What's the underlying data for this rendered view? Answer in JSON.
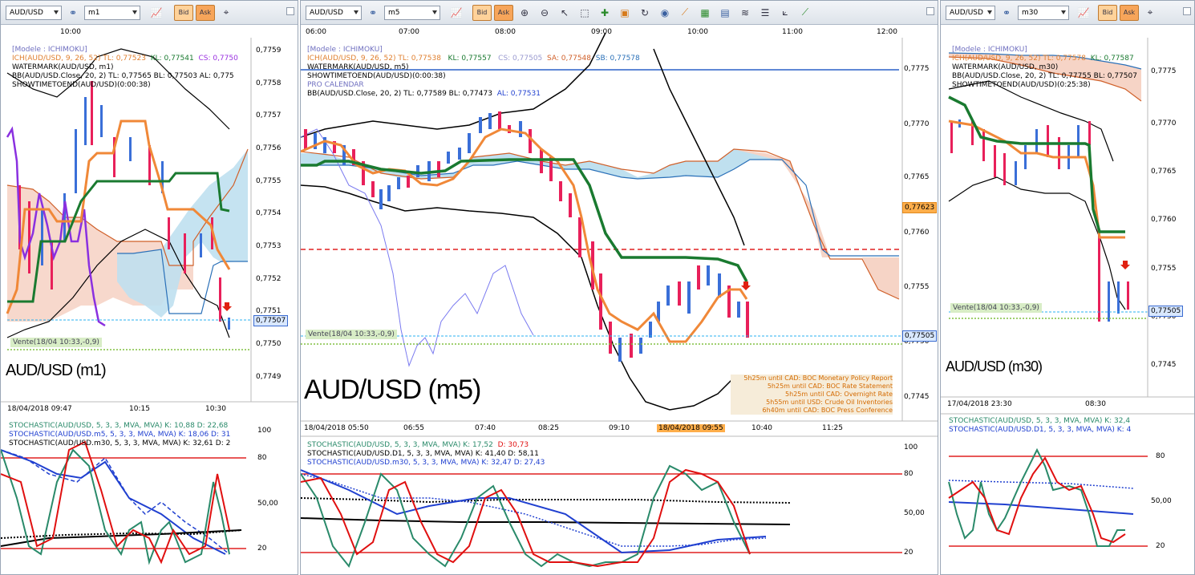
{
  "panels": [
    {
      "symbol": "AUD/USD",
      "timeframe": "m1",
      "bid": "Bid",
      "ask": "Ask",
      "time_top": [
        "10:00"
      ],
      "info": [
        {
          "text": "[Modele : ICHIMOKU]",
          "color": "#7070c0"
        },
        {
          "text": "ICH(AUD/USD, 9, 26, 52)  TL: 0,77523",
          "color": "#e08030",
          "kl": "KL: 0,77541",
          "cs": "CS: 0,7750"
        },
        {
          "text": "WATERMARK(AUD/USD, m1)",
          "color": "#000"
        },
        {
          "text": "BB(AUD/USD.Close, 20, 2)  TL: 0,77565  BL: 0,77503  AL: 0,775",
          "color": "#000"
        },
        {
          "text": "SHOWTIMETOEND(AUD/USD)(0:00:38)",
          "color": "#000"
        }
      ],
      "prices": [
        "0,7759",
        "0,7758",
        "0,7757",
        "0,7756",
        "0,7755",
        "0,7754",
        "0,7753",
        "0,7752",
        "0,7751",
        "0,7750",
        "0,7749"
      ],
      "current": "0,77507",
      "vente": "Vente(18/04 10:33,-0,9)",
      "watermark": "AUD/USD (m1)",
      "dates": [
        "18/04/2018 09:47",
        "10:15",
        "10:30"
      ],
      "stoch": [
        {
          "text": "STOCHASTIC(AUD/USD, 5, 3, 3, MVA, MVA)  K: 10,88  D: 22,68",
          "color": "#2a8a6a"
        },
        {
          "text": "STOCHASTIC(AUD/USD.m5, 5, 3, 3, MVA, MVA)  K: 18,06  D: 31",
          "color": "#2040d0"
        },
        {
          "text": "STOCHASTIC(AUD/USD.m30, 5, 3, 3, MVA, MVA)  K: 32,61  D: 2",
          "color": "#000"
        }
      ],
      "stoch_levels": [
        "100",
        "80",
        "50,00",
        "20"
      ]
    },
    {
      "symbol": "AUD/USD",
      "timeframe": "m5",
      "bid": "Bid",
      "ask": "Ask",
      "time_top": [
        "06:00",
        "07:00",
        "08:00",
        "09:00",
        "10:00",
        "11:00",
        "12:00"
      ],
      "info": [
        {
          "text": "[Modele : ICHIMOKU]",
          "color": "#7070c0"
        },
        {
          "text": "ICH(AUD/USD, 9, 26, 52)  TL: 0,77538",
          "color": "#e08030",
          "kl": "KL: 0,77557",
          "cs": "CS: 0,77505",
          "sa": "SA: 0,77548",
          "sb": "SB: 0,77578"
        },
        {
          "text": "WATERMARK(AUD/USD, m5)",
          "color": "#000"
        },
        {
          "text": "SHOWTIMETOEND(AUD/USD)(0:00:38)",
          "color": "#000"
        },
        {
          "text": "PRO CALENDAR",
          "color": "#7070c0"
        },
        {
          "text": "BB(AUD/USD.Close, 20, 2)  TL: 0,77589  BL: 0,77473",
          "color": "#000",
          "al": "AL: 0,77531"
        }
      ],
      "prices": [
        "0,7775",
        "0,7770",
        "0,7765",
        "0,7760",
        "0,7755",
        "0,7750",
        "0,7745"
      ],
      "current": "0,77505",
      "current2": "0,77623",
      "vente": "Vente(18/04 10:33,-0,9)",
      "watermark": "AUD/USD (m5)",
      "events": [
        "5h25m until CAD: BOC Monetary Policy Report",
        "5h25m until CAD: BOC Rate Statement",
        "5h25m until CAD: Overnight Rate",
        "5h55m until USD: Crude Oil Inventories",
        "6h40m until CAD: BOC Press Conference"
      ],
      "dates": [
        "18/04/2018 05:50",
        "06:55",
        "07:40",
        "08:25",
        "09:10",
        "18/04/2018 09:55",
        "10:40",
        "11:25"
      ],
      "stoch": [
        {
          "text": "STOCHASTIC(AUD/USD, 5, 3, 3, MVA, MVA)  K: 17,52",
          "color": "#2a8a6a",
          "d": "D: 30,73"
        },
        {
          "text": "STOCHASTIC(AUD/USD.D1, 5, 3, 3, MVA, MVA)  K: 41,40  D: 58,11",
          "color": "#000"
        },
        {
          "text": "STOCHASTIC(AUD/USD.m30, 5, 3, 3, MVA, MVA)  K: 32,47  D: 27,43",
          "color": "#2040d0"
        }
      ],
      "stoch_levels": [
        "100",
        "80",
        "50,00",
        "20"
      ]
    },
    {
      "symbol": "AUD/USD",
      "timeframe": "m30",
      "bid": "Bid",
      "ask": "Ask",
      "time_top": [],
      "info": [
        {
          "text": "[Modele : ICHIMOKU]",
          "color": "#7070c0"
        },
        {
          "text": "ICH(AUD/USD, 9, 26, 52)  TL: 0,77578",
          "color": "#e08030",
          "kl": "KL: 0,77587"
        },
        {
          "text": "WATERMARK(AUD/USD, m30)",
          "color": "#000"
        },
        {
          "text": "BB(AUD/USD.Close, 20, 2)  TL: 0,77755  BL: 0,77507",
          "color": "#000"
        },
        {
          "text": "SHOWTIMETOEND(AUD/USD)(0:25:38)",
          "color": "#000"
        }
      ],
      "prices": [
        "0,7775",
        "0,7770",
        "0,7765",
        "0,7760",
        "0,7755",
        "0,7750",
        "0,7745"
      ],
      "current": "0,77505",
      "vente": "Vente(18/04 10:33,-0,9)",
      "watermark": "AUD/USD (m30)",
      "dates": [
        "17/04/2018 23:30",
        "08:30"
      ],
      "stoch": [
        {
          "text": "STOCHASTIC(AUD/USD, 5, 3, 3, MVA, MVA)  K: 32,4",
          "color": "#2a8a6a"
        },
        {
          "text": "STOCHASTIC(AUD/USD.D1, 5, 3, 3, MVA, MVA)  K: 4",
          "color": "#2040d0"
        }
      ],
      "stoch_levels": [
        "80",
        "50,00",
        "20"
      ]
    }
  ],
  "colors": {
    "tenkan": "#f08838",
    "kijun": "#1a7a30",
    "bbands": "#000000",
    "cloud_bull": "#bfe0ef",
    "cloud_bear": "#f6d4c6",
    "lagging": "#8a30e0",
    "stoch_k": "#2a8a6a",
    "stoch_d": "#e01010",
    "level_line": "#e02020",
    "bull_candle": "#3a6fd8",
    "bear_candle": "#e8205a",
    "current_line": "#28b0f0",
    "vente_line": "#80c040"
  },
  "icons": [
    "currency-pair-icon",
    "chart-type-icon",
    "zoom-in-icon",
    "zoom-out-icon",
    "cursor-icon",
    "zoom-box-icon",
    "crosshair-icon",
    "comment-icon",
    "refresh-icon",
    "globe-icon",
    "ruler-icon",
    "image-icon",
    "table-icon",
    "fibonacci-icon",
    "lines-icon",
    "trend-fan-icon",
    "draw-line-icon",
    "more-icon"
  ]
}
